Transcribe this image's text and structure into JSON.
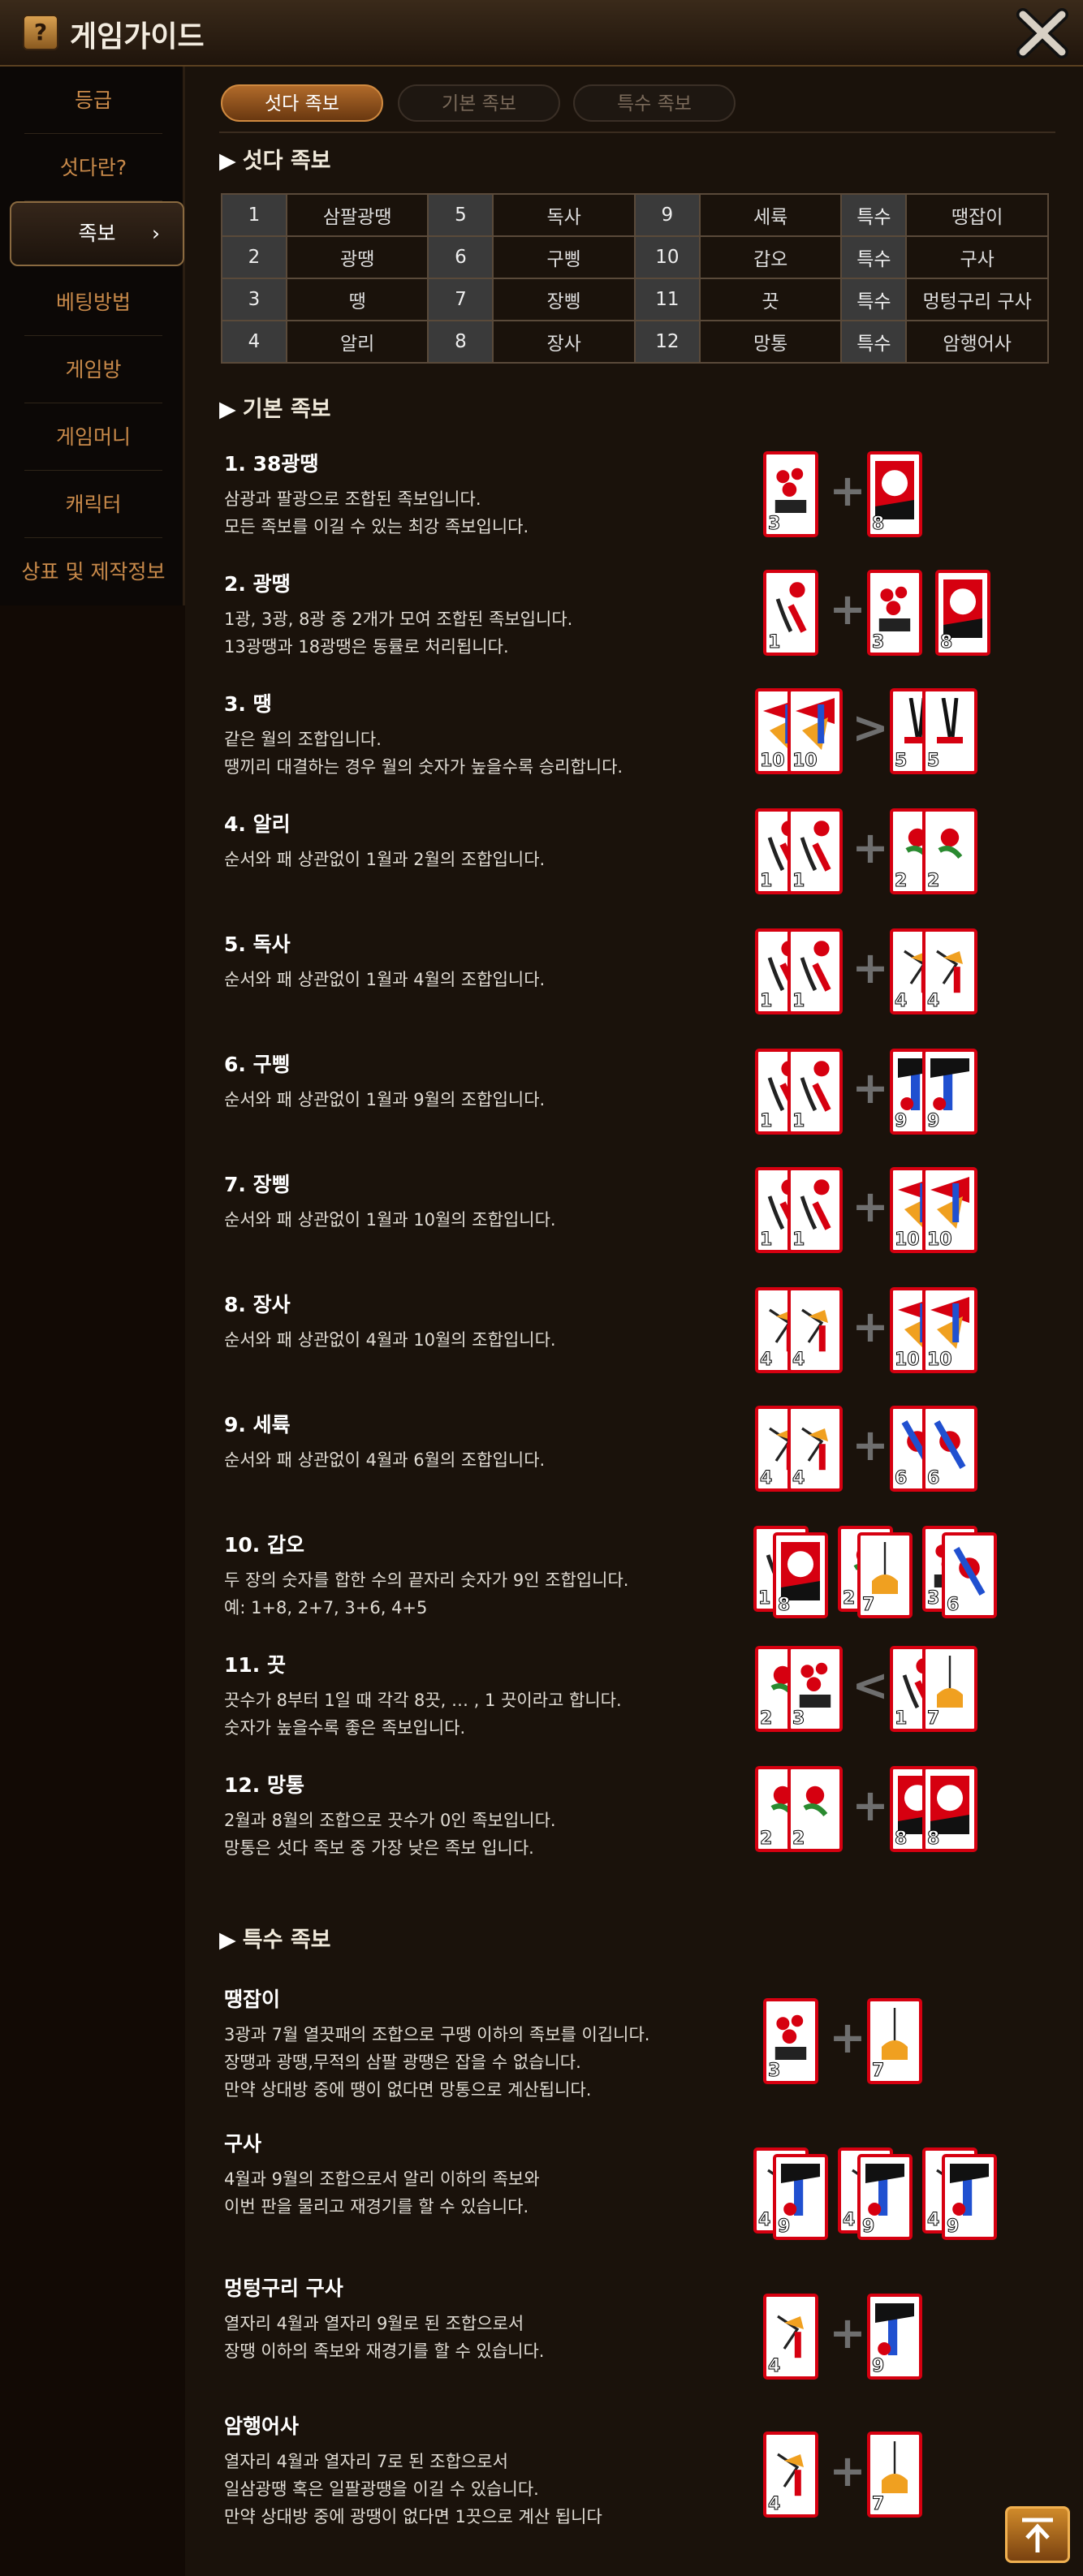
{
  "header": {
    "title": "게임가이드",
    "icon": "question-book-icon"
  },
  "sidebar": {
    "items": [
      {
        "label": "등급"
      },
      {
        "label": "섯다란?"
      },
      {
        "label": "족보",
        "active": true
      },
      {
        "label": "베팅방법"
      },
      {
        "label": "게임방"
      },
      {
        "label": "게임머니"
      },
      {
        "label": "캐릭터"
      },
      {
        "label": "상표 및 제작정보"
      }
    ],
    "chevron": "›"
  },
  "tabs": [
    {
      "label": "섯다 족보",
      "active": true
    },
    {
      "label": "기본 족보"
    },
    {
      "label": "특수 족보"
    }
  ],
  "sections": {
    "seotda": "섯다 족보",
    "basic": "기본 족보",
    "special": "특수 족보"
  },
  "rank_table": [
    [
      "1",
      "삼팔광땡",
      "5",
      "독사",
      "9",
      "세륙",
      "특수",
      "땡잡이"
    ],
    [
      "2",
      "광땡",
      "6",
      "구삥",
      "10",
      "갑오",
      "특수",
      "구사"
    ],
    [
      "3",
      "땡",
      "7",
      "장삥",
      "11",
      "끗",
      "특수",
      "멍텅구리 구사"
    ],
    [
      "4",
      "알리",
      "8",
      "장사",
      "12",
      "망통",
      "특수",
      "암행어사"
    ]
  ],
  "basic": [
    {
      "title": "1. 38광땡",
      "lines": [
        "삼광과 팔광으로 조합된 족보입니다.",
        "모든 족보를 이길 수 있는 최강 족보입니다."
      ]
    },
    {
      "title": "2. 광땡",
      "lines": [
        "1광, 3광, 8광 중 2개가 모여 조합된 족보입니다.",
        "13광땡과 18광땡은 동률로 처리됩니다."
      ]
    },
    {
      "title": "3. 땡",
      "lines": [
        "같은 월의 조합입니다.",
        "땡끼리 대결하는 경우 월의 숫자가 높을수록 승리합니다."
      ]
    },
    {
      "title": "4. 알리",
      "lines": [
        "순서와 패 상관없이 1월과 2월의 조합입니다."
      ]
    },
    {
      "title": "5. 독사",
      "lines": [
        "순서와 패 상관없이 1월과 4월의 조합입니다."
      ]
    },
    {
      "title": "6. 구삥",
      "lines": [
        "순서와 패 상관없이 1월과 9월의 조합입니다."
      ]
    },
    {
      "title": "7. 장삥",
      "lines": [
        "순서와 패 상관없이 1월과 10월의 조합입니다."
      ]
    },
    {
      "title": "8. 장사",
      "lines": [
        "순서와 패 상관없이 4월과 10월의 조합입니다."
      ]
    },
    {
      "title": "9. 세륙",
      "lines": [
        "순서와 패 상관없이 4월과 6월의 조합입니다."
      ]
    },
    {
      "title": "10. 갑오",
      "lines": [
        "두 장의 숫자를 합한 수의 끝자리 숫자가 9인 조합입니다.",
        "예: 1+8, 2+7, 3+6, 4+5"
      ]
    },
    {
      "title": "11. 끗",
      "lines": [
        "끗수가 8부터 1일 때 각각 8끗, … , 1 끗이라고 합니다.",
        "숫자가 높을수록 좋은 족보입니다."
      ]
    },
    {
      "title": "12. 망통",
      "lines": [
        "2월과 8월의 조합으로 끗수가 0인 족보입니다.",
        "망통은 섯다 족보 중 가장 낮은 족보 입니다."
      ]
    }
  ],
  "special": [
    {
      "title": "땡잡이",
      "lines": [
        "3광과 7월 열끗패의 조합으로 구땡 이하의 족보를 이깁니다.",
        "장땡과 광땡,무적의 삼팔 광땡은 잡을 수 없습니다.",
        "만약 상대방 중에 땡이 없다면 망통으로 계산됩니다."
      ]
    },
    {
      "title": "구사",
      "lines": [
        "4월과 9월의 조합으로서 알리 이하의 족보와",
        "이번 판을 물리고 재경기를 할 수 있습니다."
      ]
    },
    {
      "title": "멍텅구리 구사",
      "lines": [
        "열자리 4월과 열자리 9월로 된 조합으로서",
        "장땡 이하의 족보와 재경기를 할 수 있습니다."
      ]
    },
    {
      "title": "암행어사",
      "lines": [
        "열자리 4월과 열자리 7로 된 조합으로서",
        "일삼광땡 혹은 일팔광땡을 이길 수 있습니다.",
        "만약 상대방 중에 광땡이 없다면 1끗으로 계산 됩니다"
      ]
    }
  ],
  "card_sets": [
    {
      "left": [
        "3"
      ],
      "op": "+",
      "right": [
        "8"
      ]
    },
    {
      "left": [
        "1"
      ],
      "op": "+",
      "right": [
        "3",
        "8"
      ]
    },
    {
      "left": [
        "10",
        "10"
      ],
      "op": ">",
      "right": [
        "5",
        "5"
      ]
    },
    {
      "left": [
        "1",
        "1"
      ],
      "op": "+",
      "right": [
        "2",
        "2"
      ]
    },
    {
      "left": [
        "1",
        "1"
      ],
      "op": "+",
      "right": [
        "4",
        "4"
      ]
    },
    {
      "left": [
        "1",
        "1"
      ],
      "op": "+",
      "right": [
        "9",
        "9"
      ]
    },
    {
      "left": [
        "1",
        "1"
      ],
      "op": "+",
      "right": [
        "10",
        "10"
      ]
    },
    {
      "left": [
        "4",
        "4"
      ],
      "op": "+",
      "right": [
        "10",
        "10"
      ]
    },
    {
      "left": [
        "4",
        "4"
      ],
      "op": "+",
      "right": [
        "6",
        "6"
      ]
    },
    {
      "pairs": [
        [
          "1",
          "8"
        ],
        [
          "2",
          "7"
        ],
        [
          "3",
          "6"
        ]
      ]
    },
    {
      "left": [
        "2",
        "3"
      ],
      "op": "<",
      "right": [
        "1",
        "7"
      ]
    },
    {
      "left": [
        "2",
        "2"
      ],
      "op": "+",
      "right": [
        "8",
        "8"
      ]
    },
    {
      "left": [
        "3"
      ],
      "op": "+",
      "right": [
        "7"
      ]
    },
    {
      "pairs": [
        [
          "4",
          "9"
        ],
        [
          "4",
          "9"
        ],
        [
          "4",
          "9"
        ]
      ]
    },
    {
      "left": [
        "4"
      ],
      "op": "+",
      "right": [
        "9"
      ]
    },
    {
      "left": [
        "4"
      ],
      "op": "+",
      "right": [
        "7"
      ]
    }
  ],
  "colors": {
    "accent": "#b06a2a",
    "card_border": "#d60010",
    "sidebar_text": "#c98a4a"
  },
  "scroll_top_icon": "arrow-up-to-top-icon"
}
